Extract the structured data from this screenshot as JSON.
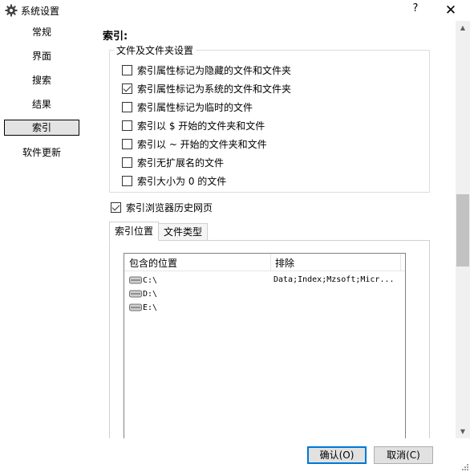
{
  "window": {
    "title": "系统设置",
    "help_label": "?",
    "close_label": "✕"
  },
  "sidebar": {
    "items": [
      {
        "label": "常规"
      },
      {
        "label": "界面"
      },
      {
        "label": "搜索"
      },
      {
        "label": "结果"
      },
      {
        "label": "索引",
        "selected": true
      },
      {
        "label": "软件更新"
      }
    ]
  },
  "main": {
    "section_title": "索引:",
    "group_title": "文件及文件夹设置",
    "options": [
      {
        "label": "索引属性标记为隐藏的文件和文件夹",
        "checked": false
      },
      {
        "label": "索引属性标记为系统的文件和文件夹",
        "checked": true
      },
      {
        "label": "索引属性标记为临时的文件",
        "checked": false
      },
      {
        "label": "索引以 $ 开始的文件夹和文件",
        "checked": false
      },
      {
        "label": "索引以 ~ 开始的文件夹和文件",
        "checked": false
      },
      {
        "label": "索引无扩展名的文件",
        "checked": false
      },
      {
        "label": "索引大小为 0 的文件",
        "checked": false
      }
    ],
    "browser_history": {
      "label": "索引浏览器历史网页",
      "checked": true
    },
    "tabs": [
      {
        "label": "索引位置",
        "active": true
      },
      {
        "label": "文件类型",
        "active": false
      }
    ],
    "locations_table": {
      "columns": [
        "包含的位置",
        "排除"
      ],
      "rows": [
        {
          "location": "C:\\",
          "exclude": "Data;Index;Mzsoft;Micr..."
        },
        {
          "location": "D:\\",
          "exclude": ""
        },
        {
          "location": "E:\\",
          "exclude": ""
        }
      ]
    }
  },
  "footer": {
    "ok_label": "确认(O)",
    "cancel_label": "取消(C)"
  },
  "icons": {
    "app": "gear-icon",
    "drive": "drive-icon"
  }
}
